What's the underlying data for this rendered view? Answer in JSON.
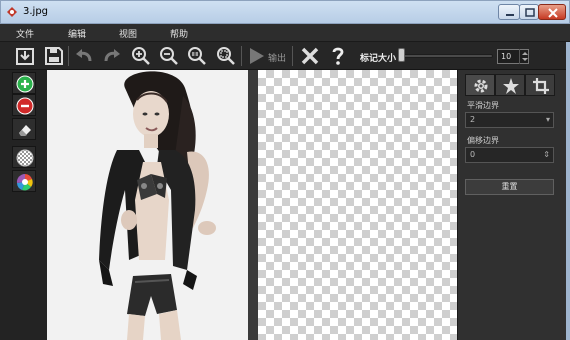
{
  "window": {
    "title": "3.jpg"
  },
  "menu": {
    "items": [
      "文件",
      "编辑",
      "视图",
      "帮助"
    ]
  },
  "toolbar": {
    "export_label": "输出",
    "marker_size_label": "标记大小",
    "marker_size_value": "10",
    "marker_slider_level": 0.02
  },
  "panel": {
    "smooth_edge_label": "平滑边界",
    "smooth_edge_value": "2",
    "offset_edge_label": "偏移边界",
    "offset_edge_value": "0",
    "reset_label": "重置"
  }
}
